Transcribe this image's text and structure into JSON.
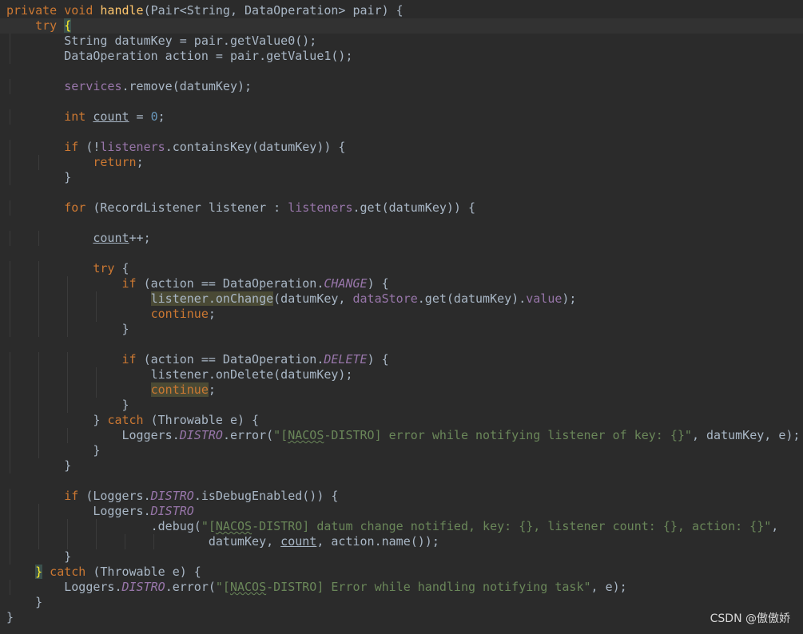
{
  "editor": {
    "current_line": 1,
    "lines": [
      [
        [
          "k",
          "private void "
        ],
        [
          "m",
          "handle"
        ],
        [
          "p",
          "(Pair<String, DataOperation> pair) {"
        ]
      ],
      [
        [
          "p",
          "    "
        ],
        [
          "k",
          "try "
        ],
        [
          "b",
          "{"
        ]
      ],
      [
        [
          "p",
          "        String datumKey = pair.getValue0();"
        ]
      ],
      [
        [
          "p",
          "        DataOperation action = pair.getValue1();"
        ]
      ],
      [],
      [
        [
          "p",
          "        "
        ],
        [
          "f",
          "services"
        ],
        [
          "p",
          ".remove(datumKey);"
        ]
      ],
      [],
      [
        [
          "p",
          "        "
        ],
        [
          "k",
          "int "
        ],
        [
          "u",
          "count"
        ],
        [
          "p",
          " = "
        ],
        [
          "n",
          "0"
        ],
        [
          "p",
          ";"
        ]
      ],
      [],
      [
        [
          "p",
          "        "
        ],
        [
          "k",
          "if "
        ],
        [
          "p",
          "(!"
        ],
        [
          "f",
          "listeners"
        ],
        [
          "p",
          ".containsKey(datumKey)) {"
        ]
      ],
      [
        [
          "p",
          "            "
        ],
        [
          "k",
          "return"
        ],
        [
          "p",
          ";"
        ]
      ],
      [
        [
          "p",
          "        }"
        ]
      ],
      [],
      [
        [
          "p",
          "        "
        ],
        [
          "k",
          "for "
        ],
        [
          "p",
          "(RecordListener listener : "
        ],
        [
          "f",
          "listeners"
        ],
        [
          "p",
          ".get(datumKey)) {"
        ]
      ],
      [],
      [
        [
          "p",
          "            "
        ],
        [
          "u",
          "count"
        ],
        [
          "p",
          "++;"
        ]
      ],
      [],
      [
        [
          "p",
          "            "
        ],
        [
          "k",
          "try "
        ],
        [
          "p",
          "{"
        ]
      ],
      [
        [
          "p",
          "                "
        ],
        [
          "k",
          "if "
        ],
        [
          "p",
          "(action == DataOperation."
        ],
        [
          "fi",
          "CHANGE"
        ],
        [
          "p",
          ") {"
        ]
      ],
      [
        [
          "p",
          "                    "
        ],
        [
          "hl",
          "listener.onChange"
        ],
        [
          "p",
          "(datumKey, "
        ],
        [
          "f",
          "dataStore"
        ],
        [
          "p",
          ".get(datumKey)."
        ],
        [
          "f",
          "value"
        ],
        [
          "p",
          ");"
        ]
      ],
      [
        [
          "p",
          "                    "
        ],
        [
          "k",
          "continue"
        ],
        [
          "p",
          ";"
        ]
      ],
      [
        [
          "p",
          "                }"
        ]
      ],
      [],
      [
        [
          "p",
          "                "
        ],
        [
          "k",
          "if "
        ],
        [
          "p",
          "(action == DataOperation."
        ],
        [
          "fi",
          "DELETE"
        ],
        [
          "p",
          ") {"
        ]
      ],
      [
        [
          "p",
          "                    listener.onDelete(datumKey);"
        ]
      ],
      [
        [
          "p",
          "                    "
        ],
        [
          "hk",
          "continue"
        ],
        [
          "p",
          ";"
        ]
      ],
      [
        [
          "p",
          "                }"
        ]
      ],
      [
        [
          "p",
          "            } "
        ],
        [
          "k",
          "catch "
        ],
        [
          "p",
          "(Throwable e) {"
        ]
      ],
      [
        [
          "p",
          "                Loggers."
        ],
        [
          "fi",
          "DISTRO"
        ],
        [
          "p",
          ".error("
        ],
        [
          "s",
          "\"["
        ],
        [
          "sq",
          "NACOS"
        ],
        [
          "s",
          "-DISTRO] error while notifying listener of key: {}\""
        ],
        [
          "p",
          ", datumKey, e);"
        ]
      ],
      [
        [
          "p",
          "            }"
        ]
      ],
      [
        [
          "p",
          "        }"
        ]
      ],
      [],
      [
        [
          "p",
          "        "
        ],
        [
          "k",
          "if "
        ],
        [
          "p",
          "(Loggers."
        ],
        [
          "fi",
          "DISTRO"
        ],
        [
          "p",
          ".isDebugEnabled()) {"
        ]
      ],
      [
        [
          "p",
          "            Loggers."
        ],
        [
          "fi",
          "DISTRO"
        ]
      ],
      [
        [
          "p",
          "                    .debug("
        ],
        [
          "s",
          "\"["
        ],
        [
          "sq",
          "NACOS"
        ],
        [
          "s",
          "-DISTRO] datum change notified, key: {}, listener count: {}, action: {}\""
        ],
        [
          "p",
          ","
        ]
      ],
      [
        [
          "p",
          "                            datumKey, "
        ],
        [
          "u",
          "count"
        ],
        [
          "p",
          ", action.name());"
        ]
      ],
      [
        [
          "p",
          "        }"
        ]
      ],
      [
        [
          "p",
          "    "
        ],
        [
          "b",
          "}"
        ],
        [
          "k",
          " catch "
        ],
        [
          "p",
          "(Throwable e) {"
        ]
      ],
      [
        [
          "p",
          "        Loggers."
        ],
        [
          "fi",
          "DISTRO"
        ],
        [
          "p",
          ".error("
        ],
        [
          "s",
          "\"["
        ],
        [
          "sq",
          "NACOS"
        ],
        [
          "s",
          "-DISTRO] Error while handling notifying task\""
        ],
        [
          "p",
          ", e);"
        ]
      ],
      [
        [
          "p",
          "    }"
        ]
      ],
      [
        [
          "p",
          "}"
        ]
      ]
    ]
  },
  "watermark": "CSDN @傲傲娇"
}
